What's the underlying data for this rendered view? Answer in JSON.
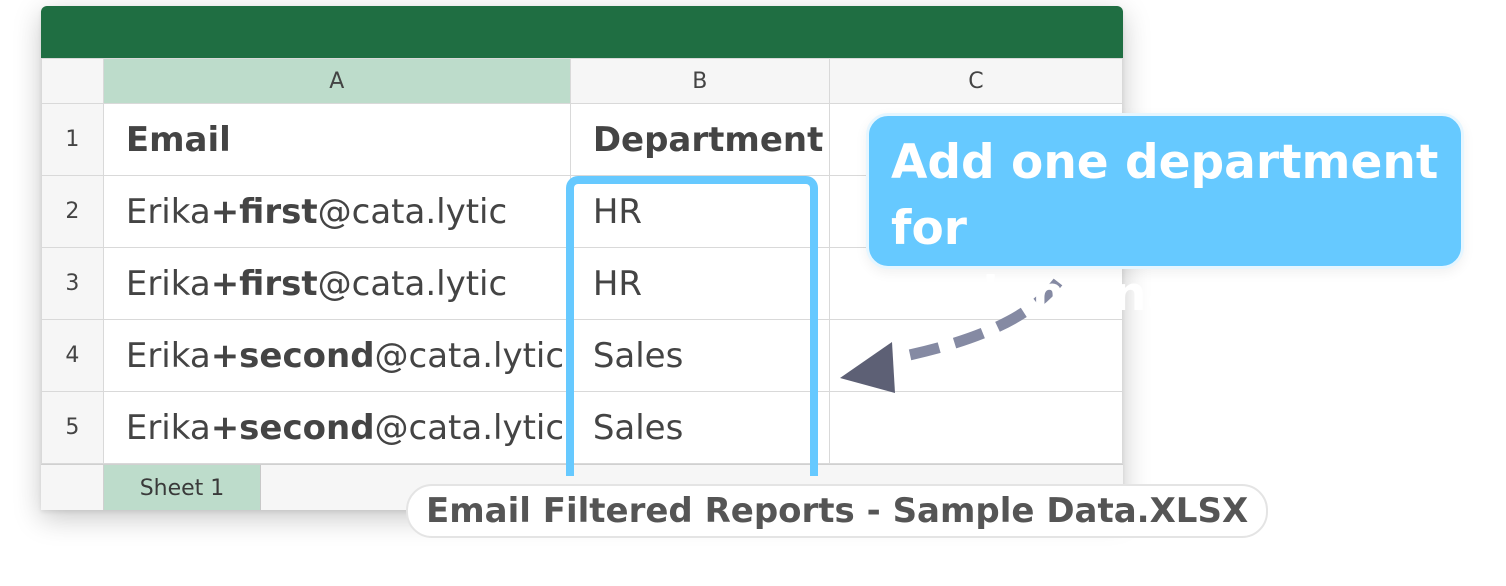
{
  "columns": [
    "A",
    "B",
    "C"
  ],
  "rows": [
    {
      "num": "1",
      "email": "Email",
      "department": "Department"
    },
    {
      "num": "2",
      "email_prefix": "Erika",
      "email_tag": "+first",
      "email_domain": "@cata.lytic",
      "department": "HR"
    },
    {
      "num": "3",
      "email_prefix": "Erika",
      "email_tag": "+first",
      "email_domain": "@cata.lytic",
      "department": "HR"
    },
    {
      "num": "4",
      "email_prefix": "Erika",
      "email_tag": "+second",
      "email_domain": "@cata.lytic",
      "department": "Sales"
    },
    {
      "num": "5",
      "email_prefix": "Erika",
      "email_tag": "+second",
      "email_domain": "@cata.lytic",
      "department": "Sales"
    }
  ],
  "sheet_tab": "Sheet 1",
  "callout": {
    "line1": "Add one department for",
    "line2": "each manager."
  },
  "filename": "Email Filtered Reports - Sample Data.XLSX",
  "colors": {
    "titlebar": "#1f6e42",
    "selected_header": "#bddccb",
    "highlight": "#66c9ff",
    "arrow": "#858aa3"
  },
  "icons": {
    "arrow": "dashed-curved-arrow-icon"
  }
}
